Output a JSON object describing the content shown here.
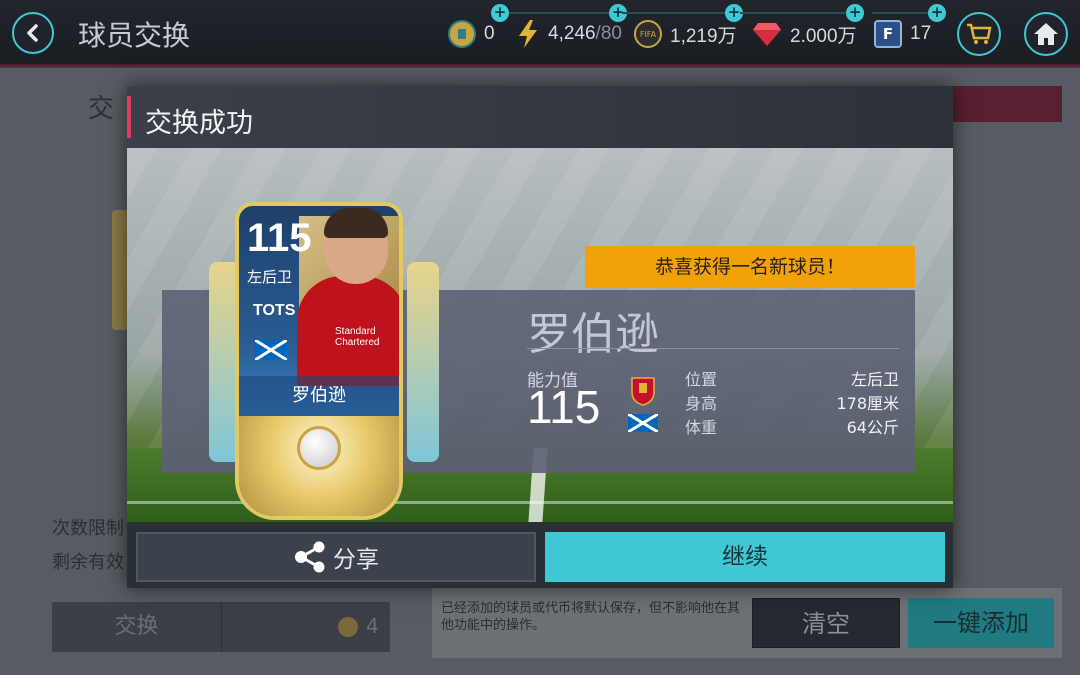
{
  "topbar": {
    "title": "球员交换",
    "resources": {
      "tokens": "0",
      "stamina": "4,246",
      "stamina_max": "/80",
      "coins": "1,219万",
      "gems": "2.000万",
      "fifa_points": "17"
    },
    "icons": [
      "back-icon",
      "token-icon",
      "lightning-icon",
      "fifa-coin-icon",
      "gem-icon",
      "fifa-points-icon",
      "cart-icon",
      "home-icon"
    ]
  },
  "background": {
    "subtitle": "交",
    "limit_text": "次数限制",
    "remaining_text": "剩余有效",
    "exchange_label": "交换",
    "exchange_cost": "4",
    "note": "已经添加的球员或代币将默认保存，但不影响他在其他功能中的操作。",
    "clear_label": "清空",
    "add_all_label": "一键添加"
  },
  "modal": {
    "title": "交换成功",
    "congrats": "恭喜获得一名新球员！",
    "player": {
      "name": "罗伯逊",
      "rating_label": "能力值",
      "rating": "115",
      "card_rating": "115",
      "card_position": "左后卫",
      "card_program": "TOTS",
      "card_name": "罗伯逊",
      "sponsor": "Standard Chartered",
      "stats": [
        {
          "label": "位置",
          "value": "左后卫"
        },
        {
          "label": "身高",
          "value": "178厘米"
        },
        {
          "label": "体重",
          "value": "64公斤"
        }
      ]
    },
    "share_label": "分享",
    "continue_label": "继续"
  },
  "colors": {
    "accent": "#3fc7d4",
    "congrats_bg": "#f1a20b",
    "header_accent": "#e23b66",
    "kit_red": "#c0121d"
  }
}
